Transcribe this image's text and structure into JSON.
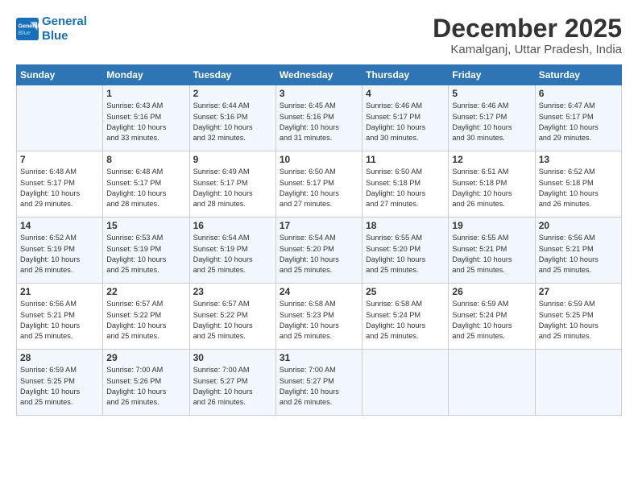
{
  "logo": {
    "line1": "General",
    "line2": "Blue"
  },
  "title": "December 2025",
  "subtitle": "Kamalganj, Uttar Pradesh, India",
  "days_header": [
    "Sunday",
    "Monday",
    "Tuesday",
    "Wednesday",
    "Thursday",
    "Friday",
    "Saturday"
  ],
  "weeks": [
    [
      {
        "day": "",
        "info": ""
      },
      {
        "day": "1",
        "info": "Sunrise: 6:43 AM\nSunset: 5:16 PM\nDaylight: 10 hours\nand 33 minutes."
      },
      {
        "day": "2",
        "info": "Sunrise: 6:44 AM\nSunset: 5:16 PM\nDaylight: 10 hours\nand 32 minutes."
      },
      {
        "day": "3",
        "info": "Sunrise: 6:45 AM\nSunset: 5:16 PM\nDaylight: 10 hours\nand 31 minutes."
      },
      {
        "day": "4",
        "info": "Sunrise: 6:46 AM\nSunset: 5:17 PM\nDaylight: 10 hours\nand 30 minutes."
      },
      {
        "day": "5",
        "info": "Sunrise: 6:46 AM\nSunset: 5:17 PM\nDaylight: 10 hours\nand 30 minutes."
      },
      {
        "day": "6",
        "info": "Sunrise: 6:47 AM\nSunset: 5:17 PM\nDaylight: 10 hours\nand 29 minutes."
      }
    ],
    [
      {
        "day": "7",
        "info": "Sunrise: 6:48 AM\nSunset: 5:17 PM\nDaylight: 10 hours\nand 29 minutes."
      },
      {
        "day": "8",
        "info": "Sunrise: 6:48 AM\nSunset: 5:17 PM\nDaylight: 10 hours\nand 28 minutes."
      },
      {
        "day": "9",
        "info": "Sunrise: 6:49 AM\nSunset: 5:17 PM\nDaylight: 10 hours\nand 28 minutes."
      },
      {
        "day": "10",
        "info": "Sunrise: 6:50 AM\nSunset: 5:17 PM\nDaylight: 10 hours\nand 27 minutes."
      },
      {
        "day": "11",
        "info": "Sunrise: 6:50 AM\nSunset: 5:18 PM\nDaylight: 10 hours\nand 27 minutes."
      },
      {
        "day": "12",
        "info": "Sunrise: 6:51 AM\nSunset: 5:18 PM\nDaylight: 10 hours\nand 26 minutes."
      },
      {
        "day": "13",
        "info": "Sunrise: 6:52 AM\nSunset: 5:18 PM\nDaylight: 10 hours\nand 26 minutes."
      }
    ],
    [
      {
        "day": "14",
        "info": "Sunrise: 6:52 AM\nSunset: 5:19 PM\nDaylight: 10 hours\nand 26 minutes."
      },
      {
        "day": "15",
        "info": "Sunrise: 6:53 AM\nSunset: 5:19 PM\nDaylight: 10 hours\nand 25 minutes."
      },
      {
        "day": "16",
        "info": "Sunrise: 6:54 AM\nSunset: 5:19 PM\nDaylight: 10 hours\nand 25 minutes."
      },
      {
        "day": "17",
        "info": "Sunrise: 6:54 AM\nSunset: 5:20 PM\nDaylight: 10 hours\nand 25 minutes."
      },
      {
        "day": "18",
        "info": "Sunrise: 6:55 AM\nSunset: 5:20 PM\nDaylight: 10 hours\nand 25 minutes."
      },
      {
        "day": "19",
        "info": "Sunrise: 6:55 AM\nSunset: 5:21 PM\nDaylight: 10 hours\nand 25 minutes."
      },
      {
        "day": "20",
        "info": "Sunrise: 6:56 AM\nSunset: 5:21 PM\nDaylight: 10 hours\nand 25 minutes."
      }
    ],
    [
      {
        "day": "21",
        "info": "Sunrise: 6:56 AM\nSunset: 5:21 PM\nDaylight: 10 hours\nand 25 minutes."
      },
      {
        "day": "22",
        "info": "Sunrise: 6:57 AM\nSunset: 5:22 PM\nDaylight: 10 hours\nand 25 minutes."
      },
      {
        "day": "23",
        "info": "Sunrise: 6:57 AM\nSunset: 5:22 PM\nDaylight: 10 hours\nand 25 minutes."
      },
      {
        "day": "24",
        "info": "Sunrise: 6:58 AM\nSunset: 5:23 PM\nDaylight: 10 hours\nand 25 minutes."
      },
      {
        "day": "25",
        "info": "Sunrise: 6:58 AM\nSunset: 5:24 PM\nDaylight: 10 hours\nand 25 minutes."
      },
      {
        "day": "26",
        "info": "Sunrise: 6:59 AM\nSunset: 5:24 PM\nDaylight: 10 hours\nand 25 minutes."
      },
      {
        "day": "27",
        "info": "Sunrise: 6:59 AM\nSunset: 5:25 PM\nDaylight: 10 hours\nand 25 minutes."
      }
    ],
    [
      {
        "day": "28",
        "info": "Sunrise: 6:59 AM\nSunset: 5:25 PM\nDaylight: 10 hours\nand 25 minutes."
      },
      {
        "day": "29",
        "info": "Sunrise: 7:00 AM\nSunset: 5:26 PM\nDaylight: 10 hours\nand 26 minutes."
      },
      {
        "day": "30",
        "info": "Sunrise: 7:00 AM\nSunset: 5:27 PM\nDaylight: 10 hours\nand 26 minutes."
      },
      {
        "day": "31",
        "info": "Sunrise: 7:00 AM\nSunset: 5:27 PM\nDaylight: 10 hours\nand 26 minutes."
      },
      {
        "day": "",
        "info": ""
      },
      {
        "day": "",
        "info": ""
      },
      {
        "day": "",
        "info": ""
      }
    ]
  ]
}
